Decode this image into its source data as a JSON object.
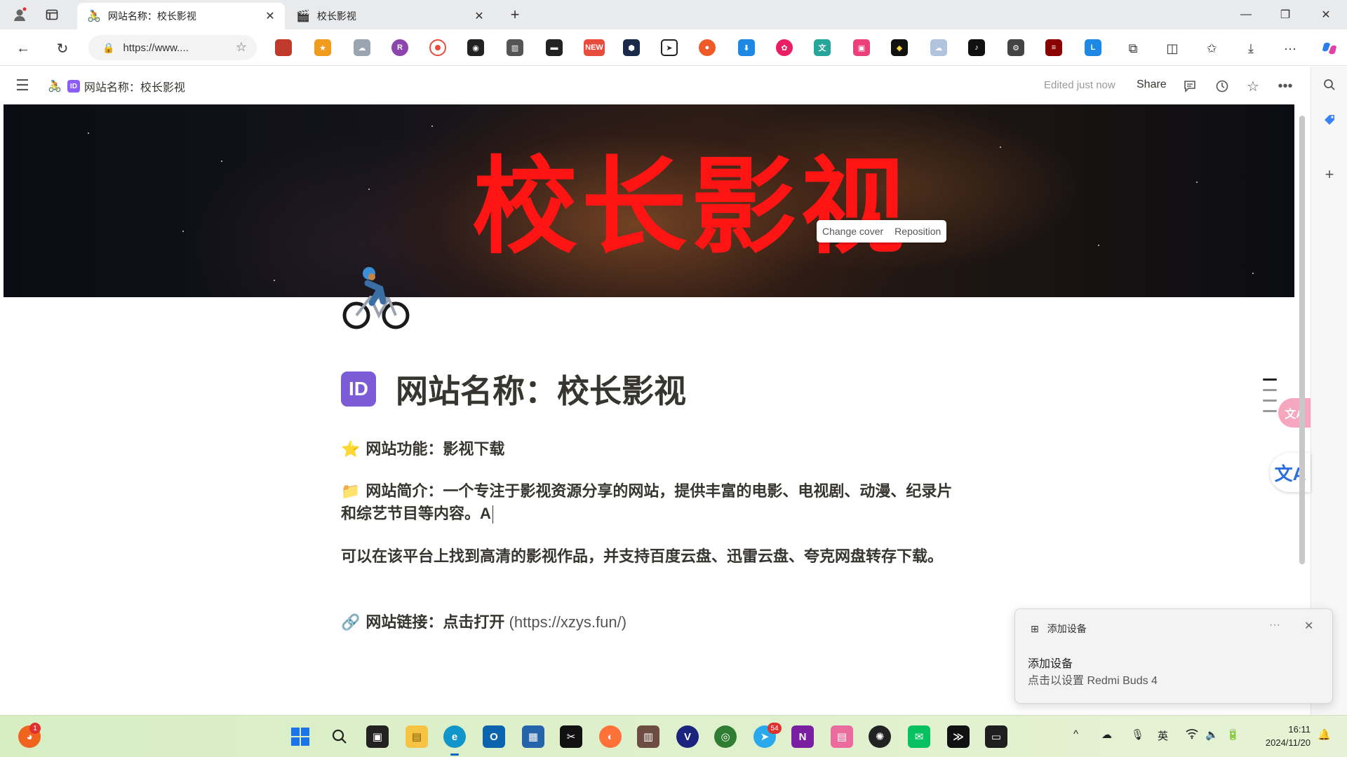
{
  "browser": {
    "tabs": [
      {
        "title": "网站名称：校长影视",
        "active": true
      },
      {
        "title": "校长影视",
        "active": false
      }
    ],
    "new_tab_label": "+",
    "url": "https://www...."
  },
  "notion": {
    "breadcrumb": "网站名称：校长影视",
    "id_badge": "ID",
    "edited": "Edited just now",
    "share": "Share"
  },
  "cover": {
    "title": "校长影视",
    "change_cover": "Change cover",
    "reposition": "Reposition"
  },
  "page": {
    "title": "网站名称：校长影视",
    "feature": "网站功能：影视下载",
    "intro": "网站简介：一个专注于影视资源分享的网站，提供丰富的电影、电视剧、动漫、纪录片和综艺节目等内容。A",
    "more": "可以在该平台上找到高清的影视作品，并支持百度云盘、迅雷云盘、夸克网盘转存下载。",
    "link_label": "网站链接：点击打开",
    "link_url": "(https://xzys.fun/)"
  },
  "toast": {
    "header": "添加设备",
    "more": "···",
    "title": "添加设备",
    "body": "点击以设置 Redmi Buds 4"
  },
  "taskbar": {
    "ime": "英",
    "time": "16:11",
    "date": "2024/11/20",
    "notification_badge": "1",
    "telegram_badge": "54"
  },
  "colors": {
    "cover_title": "#ff1414",
    "id_badge": "#7c5cd6",
    "taskbar": "#dff0cc"
  }
}
